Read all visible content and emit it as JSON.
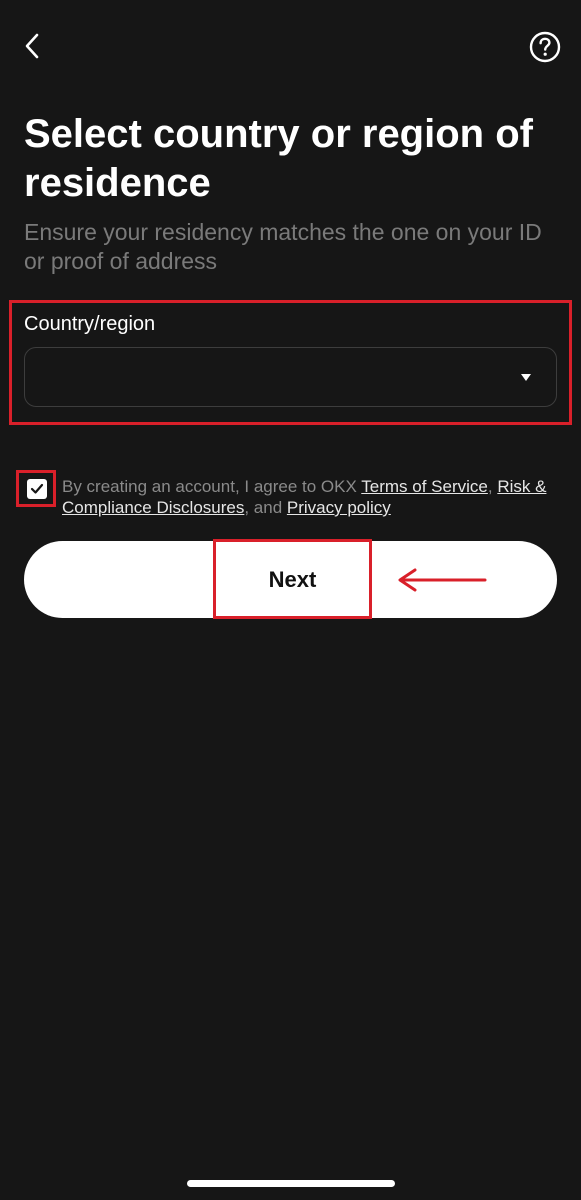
{
  "header": {
    "back_icon": "chevron-left-icon",
    "help_icon": "question-circle-icon"
  },
  "page": {
    "title": "Select country or region of residence",
    "subtitle": "Ensure your residency matches the one on your ID or proof of address"
  },
  "country_field": {
    "label": "Country/region",
    "value": "",
    "dropdown_icon": "caret-down-icon"
  },
  "agreement": {
    "checked": true,
    "prefix": "By creating an account, I agree to OKX ",
    "terms_link": "Terms of Service",
    "comma": ",",
    "risk_link": "Risk & Compliance Disclosures",
    "and_text": ", and ",
    "privacy_link": "Privacy policy"
  },
  "next_button": {
    "label": "Next"
  },
  "colors": {
    "background": "#161616",
    "annotation_red": "#d9202a",
    "button_bg": "#ffffff",
    "muted_text": "#7a7a7a"
  }
}
